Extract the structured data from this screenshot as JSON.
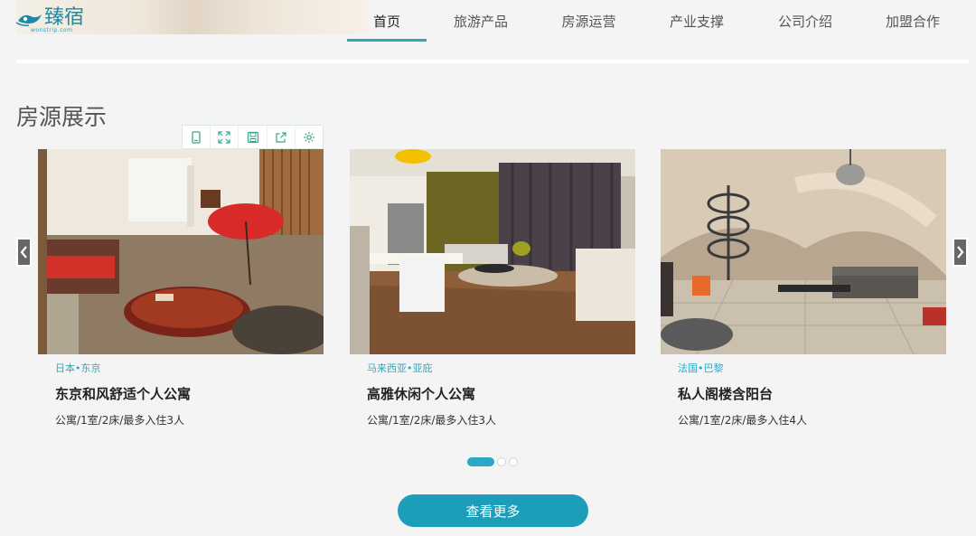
{
  "header": {
    "logo_text": "臻宿",
    "logo_sub": "wonstrip.com",
    "nav": [
      {
        "label": "首页",
        "active": true
      },
      {
        "label": "旅游产品",
        "active": false
      },
      {
        "label": "房源运营",
        "active": false
      },
      {
        "label": "产业支撑",
        "active": false
      },
      {
        "label": "公司介绍",
        "active": false
      },
      {
        "label": "加盟合作",
        "active": false
      }
    ]
  },
  "section": {
    "title": "房源展示"
  },
  "toolbar": {
    "icons": [
      "tablet-icon",
      "expand-icon",
      "save-icon",
      "share-icon",
      "settings-icon"
    ]
  },
  "cards": [
    {
      "location": "日本•东京",
      "title": "东京和风舒适个人公寓",
      "desc": "公寓/1室/2床/最多入住3人"
    },
    {
      "location": "马来西亚•亚庇",
      "title": "高雅休闲个人公寓",
      "desc": "公寓/1室/2床/最多入住3人"
    },
    {
      "location": "法国•巴黎",
      "title": "私人阁楼含阳台",
      "desc": "公寓/1室/2床/最多入住4人"
    }
  ],
  "pager": {
    "count": 3,
    "active_index": 0
  },
  "more_button": {
    "label": "查看更多"
  },
  "colors": {
    "accent": "#2aa8c4",
    "button": "#1c9db9"
  }
}
